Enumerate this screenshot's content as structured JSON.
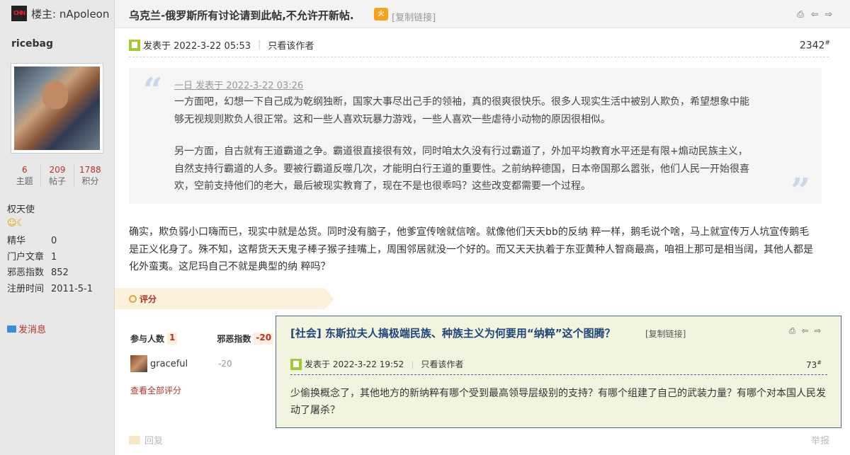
{
  "header": {
    "logo_text": "CHN",
    "op_label": "楼主: nApoleon",
    "thread_title": "乌克兰-俄罗斯所有讨论请到此帖,不允许开新帖.",
    "hot_badge": "火",
    "copy_link": "[复制链接]"
  },
  "sidebar": {
    "username": "ricebag",
    "stats": [
      {
        "value": "6",
        "label": "主题"
      },
      {
        "value": "209",
        "label": "帖子"
      },
      {
        "value": "1788",
        "label": "积分"
      }
    ],
    "user_group": "权天使",
    "medals": "☺☾",
    "info": [
      {
        "key": "精华",
        "value": "0"
      },
      {
        "key": "门户文章",
        "value": "1"
      },
      {
        "key": "邪恶指数",
        "value": "852"
      },
      {
        "key": "注册时间",
        "value": "2011-5-1"
      }
    ],
    "pm_label": "发消息"
  },
  "post": {
    "posted_at": "发表于 2022-3-22 05:53",
    "only_author": "只看该作者",
    "floor": "2342",
    "floor_sup": "#",
    "quote": {
      "meta": "一日 发表于 2022-3-22 03:26",
      "paragraphs": [
        "一方面吧，幻想一下自己成为乾纲独断，国家大事尽出己手的领袖，真的很爽很快乐。很多人现实生活中被别人欺负，希望想象中能够无视规则欺负人很正常。这和一些人喜欢玩暴力游戏，一些人喜欢一些虐待小动物的原因很相似。",
        "另一方面，自古就有王道霸道之争。霸道很直接很有效，同时咱太久没有行过霸道了，外加平均教育水平还是有限+煽动民族主义，自然支持行霸道的人多。要被行霸道反噬几次，才能明白行王道的重要性。之前纳粹德国，日本帝国那么嚣张，他们人民一开始很喜欢，空前支持他们的老大，最后被现实教育了，现在不是也很乖吗？这些改变都需要一个过程。"
      ]
    },
    "body": "确实，欺负弱小口嗨而已，现实中就是怂货。同时没有脑子，他爹宣传啥就信啥。就像他们天天bb的反纳 粹一样，鹅毛说个啥，马上就宣传万人坑宣传鹅毛是正义化身了。殊不知，这帮货天天鬼子棒子猴子挂嘴上，周围邻居就没一个好的。而又天天执着于东亚黄种人智商最高，咱祖上那可是相当阔，其他人都是化外蛮夷。这尼玛自己不就是典型的纳 粹吗？"
  },
  "rating": {
    "label": "评分",
    "participants_label": "参与人数",
    "participants_count": "1",
    "evil_label": "邪恶指数",
    "evil_total": "-20",
    "rows": [
      {
        "user": "graceful",
        "score": "-20"
      }
    ],
    "view_all": "查看全部评分"
  },
  "footer": {
    "reply": "回复",
    "report": "举报"
  },
  "popup": {
    "title": "[社会] 东斯拉夫人搞极端民族、种族主义为何要用“纳粹”这个图腾？",
    "copy_link": "[复制链接]",
    "posted_at": "发表于 2022-3-22 19:52",
    "only_author": "只看该作者",
    "floor": "73",
    "floor_sup": "#",
    "body": "少偷换概念了，其他地方的新纳粹有哪个受到最高领导层级别的支持？有哪个组建了自己的武装力量？有哪个对本国人民发动了屠杀？"
  },
  "colors": {
    "accent_red": "#b3312a",
    "popup_border": "#4e6a8a",
    "popup_bg": "#f3f4e0",
    "popup_title": "#20457a",
    "rating_bg": "#fcf1dc"
  }
}
